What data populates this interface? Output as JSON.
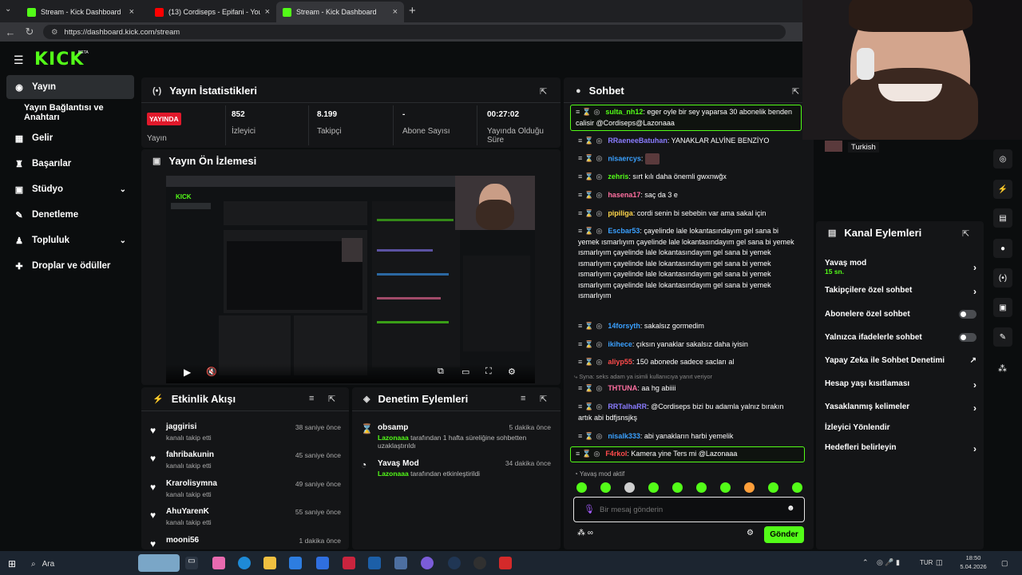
{
  "browser": {
    "tabs": [
      {
        "label": "Stream - Kick Dashboard",
        "color": "#53fc18"
      },
      {
        "label": "(13) Cordiseps - Epifani - YouTube",
        "color": "#ff0000"
      },
      {
        "label": "Stream - Kick Dashboard",
        "color": "#53fc18"
      }
    ],
    "new_tab": "+",
    "url": "https://dashboard.kick.com/stream"
  },
  "brand": {
    "logo": "KICK",
    "beta": "BETA",
    "accent": "#53fc18"
  },
  "sidebar": {
    "items": [
      {
        "label": "Yayın",
        "icon": "broadcast-icon"
      },
      {
        "label": "Yayın Bağlantısı ve Anahtarı"
      },
      {
        "label": "Gelir",
        "icon": "revenue-icon"
      },
      {
        "label": "Başarılar",
        "icon": "trophy-icon"
      },
      {
        "label": "Stüdyo",
        "icon": "studio-icon"
      },
      {
        "label": "Denetleme",
        "icon": "wrench-icon"
      },
      {
        "label": "Topluluk",
        "icon": "community-icon"
      },
      {
        "label": "Droplar ve ödüller",
        "icon": "gift-icon"
      }
    ]
  },
  "stats": {
    "title": "Yayın İstatistikleri",
    "live_badge": "YAYINDA",
    "live_label": "Yayın",
    "viewers_value": "852",
    "viewers_label": "İzleyici",
    "followers_value": "8.199",
    "followers_label": "Takipçi",
    "subs_value": "-",
    "subs_label": "Abone Sayısı",
    "duration_value": "00:27:02",
    "duration_label": "Yayında Olduğu Süre"
  },
  "preview": {
    "title": "Yayın Ön İzlemesi"
  },
  "activity": {
    "title": "Etkinlik Akışı",
    "items": [
      {
        "name": "jaggirisi",
        "sub": "kanalı takip etti",
        "time": "38 saniye önce"
      },
      {
        "name": "fahribakunin",
        "sub": "kanalı takip etti",
        "time": "45 saniye önce"
      },
      {
        "name": "Krarolisymna",
        "sub": "kanalı takip etti",
        "time": "49 saniye önce"
      },
      {
        "name": "AhuYarenK",
        "sub": "kanalı takip etti",
        "time": "55 saniye önce"
      },
      {
        "name": "mooni56",
        "sub": "",
        "time": "1 dakika önce"
      }
    ]
  },
  "moderation": {
    "title": "Denetim Eylemleri",
    "items": [
      {
        "name": "obsamp",
        "time": "5 dakika önce",
        "actor": "Lazonaaa",
        "text": "tarafından 1 hafta süreliğine sohbetten uzaklaştırıldı"
      },
      {
        "name": "Yavaş Mod",
        "time": "34 dakika önce",
        "actor": "Lazonaaa",
        "text": "tarafından etkinleştirildi"
      }
    ]
  },
  "chat": {
    "title": "Sohbet",
    "messages": [
      {
        "user": "sulta_nh12",
        "color": "#53fc18",
        "text": ": eger oyle bir sey yaparsa 30 abonelik benden calisir @Cordiseps@Lazonaaa"
      },
      {
        "user": "RRaeneeBatuhan",
        "color": "#8a7cff",
        "text": ": YANAKLAR ALVİNE BENZİYO"
      },
      {
        "user": "nisaercys",
        "color": "#3aa0ff",
        "text": ":"
      },
      {
        "user": "zehris",
        "color": "#53fc18",
        "text": ": sırt kılı daha önemli gwxnwğx"
      },
      {
        "user": "hasena17",
        "color": "#ff6fa0",
        "text": ": saç da 3 e"
      },
      {
        "user": "pipiliga",
        "color": "#ffd54a",
        "text": ": cordi senin bi sebebin var ama sakal için"
      },
      {
        "user": "Escbar53",
        "color": "#3aa0ff",
        "text": ": çayelinde lale lokantasındayım gel sana bi yemek ısmarlıyım çayelinde lale lokantasındayım gel sana bi yemek ısmarlıyım çayelinde lale lokantasındayım gel sana bi yemek ısmarlıyım çayelinde lale lokantasındayım gel sana bi yemek ısmarlıyım çayelinde lale lokantasındayım gel sana bi yemek ısmarlıyım çayelinde lale lokantasındayım gel sana bi yemek ısmarlıyım"
      },
      {
        "user": "14forsyth",
        "color": "#3aa0ff",
        "text": ": sakalsız gormedim"
      },
      {
        "user": "ikihece",
        "color": "#3aa0ff",
        "text": ": çıksın yanaklar sakalsız daha iyisin"
      },
      {
        "user": "aliyp55",
        "color": "#ff4b4b",
        "text": ": 150 abonede sadece sacları al"
      },
      {
        "user": "THTUNA",
        "color": "#ff6fa0",
        "text": ": aa hg abiiii"
      },
      {
        "user": "RRTalhaRR",
        "color": "#8a7cff",
        "text": ": @Cordiseps bizi bu adamla yalnız bırakın artık abi bdfjsnsjkş"
      },
      {
        "user": "nisalk333",
        "color": "#3aa0ff",
        "text": ": abi yanakların harbi yemelik"
      },
      {
        "user": "F4rkol",
        "color": "#ff4b4b",
        "text": ": Kamera yine Ters mi @Lazonaaa"
      }
    ],
    "reply_note": "Syna: seks adam ya isimli kullanıcıya yanıt veriyor",
    "slow_mode": "Yavaş mod aktif",
    "input_placeholder": "Bir mesaj gönderin",
    "send": "Gönder"
  },
  "cam": {
    "tag": "Turkish"
  },
  "channel_actions": {
    "title": "Kanal Eylemleri",
    "items": [
      {
        "label": "Yavaş mod",
        "sub": "15 sn.",
        "control": "chevron"
      },
      {
        "label": "Takipçilere özel sohbet",
        "control": "chevron"
      },
      {
        "label": "Abonelere özel sohbet",
        "control": "toggle"
      },
      {
        "label": "Yalnızca ifadelerle sohbet",
        "control": "toggle"
      },
      {
        "label": "Yapay Zeka ile Sohbet Denetimi",
        "control": "external"
      },
      {
        "label": "Hesap yaşı kısıtlaması",
        "control": "chevron"
      },
      {
        "label": "Yasaklanmış kelimeler",
        "control": "chevron"
      },
      {
        "label": "İzleyici Yönlendir",
        "control": "none"
      },
      {
        "label": "Hedefleri belirleyin",
        "control": "chevron"
      }
    ]
  },
  "taskbar": {
    "search": "Ara",
    "lang": "TUR",
    "time": "18:50",
    "date": "5.04.2026"
  }
}
